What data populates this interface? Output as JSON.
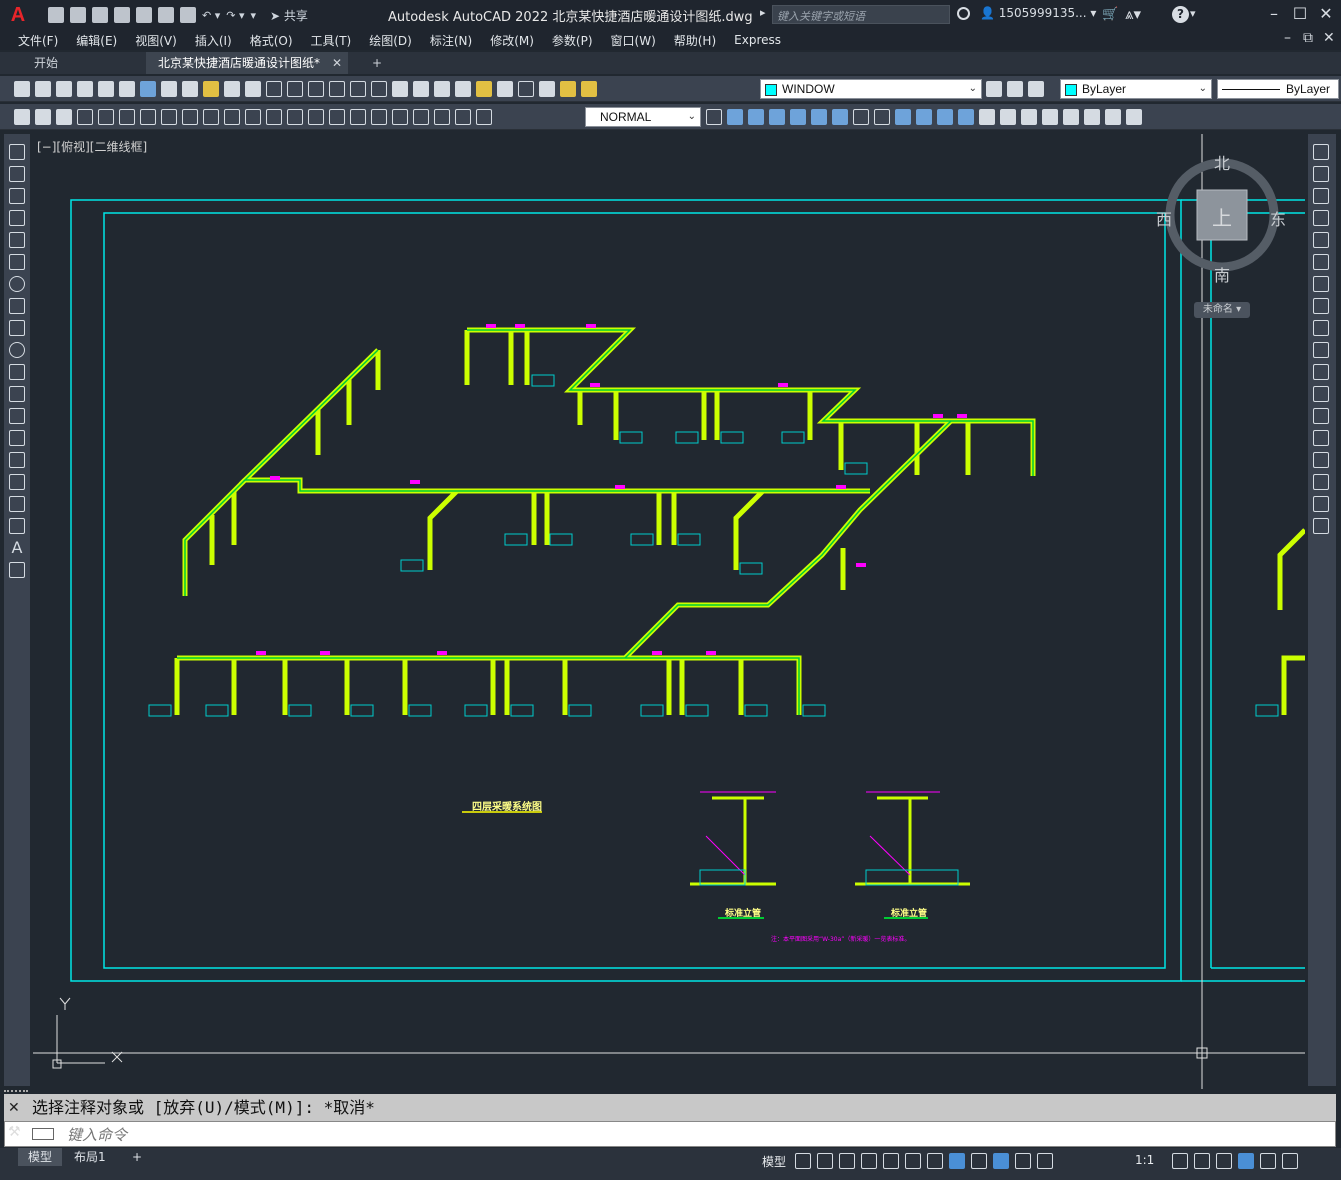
{
  "app": {
    "logo": "A",
    "title": "Autodesk AutoCAD 2022    北京某快捷酒店暖通设计图纸.dwg",
    "search_placeholder": "键入关键字或短语",
    "user": "1505999135...",
    "share_label": "共享"
  },
  "menu": [
    "文件(F)",
    "编辑(E)",
    "视图(V)",
    "插入(I)",
    "格式(O)",
    "工具(T)",
    "绘图(D)",
    "标注(N)",
    "修改(M)",
    "参数(P)",
    "窗口(W)",
    "帮助(H)",
    "Express"
  ],
  "tabs": {
    "start": "开始",
    "active": "北京某快捷酒店暖通设计图纸*",
    "close": "✕",
    "add": "+"
  },
  "toolbar": {
    "layer_value": "WINDOW",
    "color_value": "ByLayer",
    "linetype_value": "ByLayer",
    "dimstyle_value": "NORMAL",
    "layer_color": "#00ffff"
  },
  "viewport": {
    "label": "[−][俯视][二维线框]"
  },
  "viewcube": {
    "north": "北",
    "south": "南",
    "east": "东",
    "west": "西",
    "face": "上",
    "named_view": "未命名"
  },
  "drawing": {
    "system_title": "四层采暖系统图",
    "standard_riser_1": "标准立管",
    "standard_riser_2": "标准立管",
    "note": "注：本平面图采用“W-30a”（新采暖）一览表标准。",
    "ucs_y": "Y",
    "ucs_x": "X",
    "colors": {
      "frame": "#00e5e5",
      "pipe_outer": "#ccff00",
      "pipe_inner": "#00cc33",
      "label": "#ff00ff",
      "radiator": "#00cccc",
      "crosshair": "#ffffff"
    }
  },
  "command": {
    "history": "选择注释对象或 [放弃(U)/模式(M)]: *取消*",
    "input_placeholder": "键入命令",
    "close": "✕",
    "wrench": "🔧"
  },
  "layout_tabs": {
    "model": "模型",
    "layout1": "布局1",
    "add": "+"
  },
  "status": {
    "model": "模型",
    "scale": "1:1"
  }
}
